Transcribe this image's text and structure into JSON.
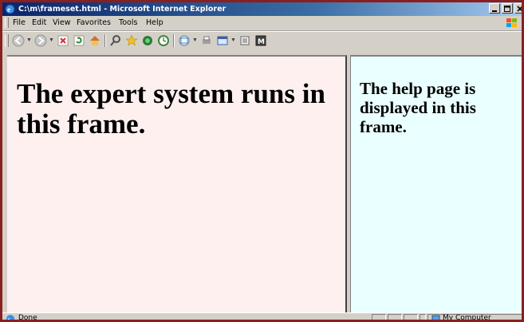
{
  "window": {
    "title": "C:\\m\\frameset.html - Microsoft Internet Explorer"
  },
  "menu": {
    "file": "File",
    "edit": "Edit",
    "view": "View",
    "favorites": "Favorites",
    "tools": "Tools",
    "help": "Help"
  },
  "toolbar_icons": [
    "back-icon",
    "forward-icon",
    "stop-icon",
    "refresh-icon",
    "home-icon",
    "search-icon",
    "favorites-icon",
    "media-icon",
    "history-icon",
    "mail-icon",
    "print-icon",
    "edit-icon",
    "discuss-icon",
    "messenger-icon"
  ],
  "frames": {
    "left_text": "The expert system runs in this frame.",
    "right_text": "The help page is displayed in this frame.",
    "left_bg": "#fff0f0",
    "right_bg": "#eaffff"
  },
  "status": {
    "text": "Done",
    "zone": "My Computer"
  }
}
